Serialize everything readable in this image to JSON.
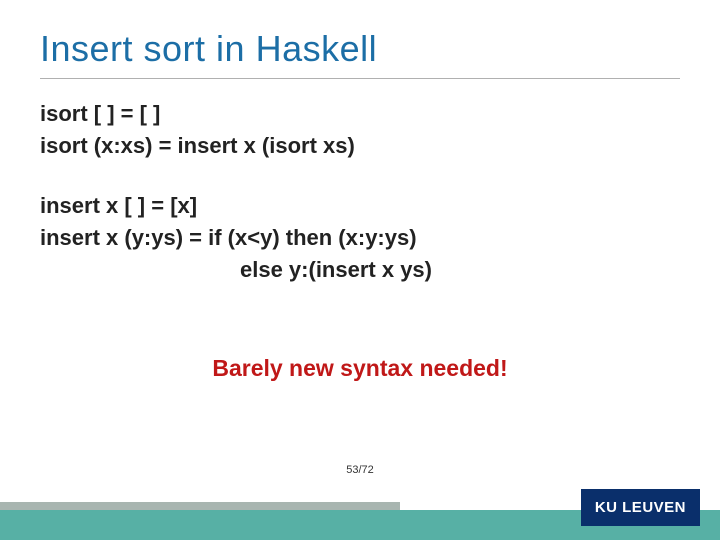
{
  "title": "Insert sort in Haskell",
  "code": {
    "isort_base": "isort [ ] = [ ]",
    "isort_rec": "isort (x:xs) = insert x (isort xs)",
    "insert_base": "insert x [ ] = [x]",
    "insert_rec": "insert x (y:ys) = if (x<y) then (x:y:ys)",
    "insert_else": "else y:(insert x ys)"
  },
  "callout": "Barely new syntax needed!",
  "page": "53/72",
  "logo": "KU LEUVEN"
}
